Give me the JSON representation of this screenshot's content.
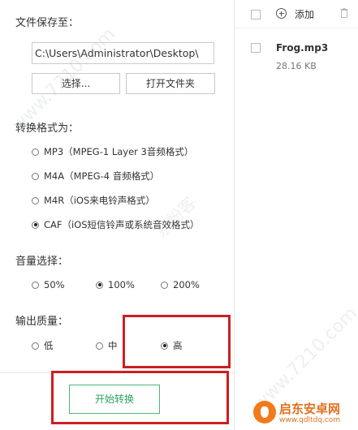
{
  "save": {
    "title": "文件保存至：",
    "path": "C:\\Users\\Administrator\\Desktop\\",
    "choose_label": "选择...",
    "open_folder_label": "打开文件夹"
  },
  "format": {
    "title": "转换格式为：",
    "options": [
      {
        "label": "MP3（MPEG-1 Layer 3音频格式）",
        "selected": false
      },
      {
        "label": "M4A（MPEG-4 音频格式）",
        "selected": false
      },
      {
        "label": "M4R（iOS来电铃声格式）",
        "selected": false
      },
      {
        "label": "CAF（iOS短信铃声或系统音效格式）",
        "selected": true
      }
    ]
  },
  "volume": {
    "title": "音量选择：",
    "options": [
      {
        "label": "50%",
        "selected": false
      },
      {
        "label": "100%",
        "selected": true
      },
      {
        "label": "200%",
        "selected": false
      }
    ]
  },
  "quality": {
    "title": "输出质量：",
    "options": [
      {
        "label": "低",
        "selected": false
      },
      {
        "label": "中",
        "selected": false
      },
      {
        "label": "高",
        "selected": true
      }
    ]
  },
  "start_label": "开始转换",
  "toolbar": {
    "add_label": "添加"
  },
  "files": [
    {
      "name": "Frog.mp3",
      "size": "28.16 KB"
    }
  ],
  "watermarks": {
    "site_url": "www.7210.com",
    "cn_mark": "系粉客"
  },
  "logo": {
    "name": "启东安卓网",
    "url": "www.qdltdq.com"
  },
  "colors": {
    "highlight": "#cc1f1f",
    "start_button": "#2aa35f",
    "logo": "#e07020"
  }
}
